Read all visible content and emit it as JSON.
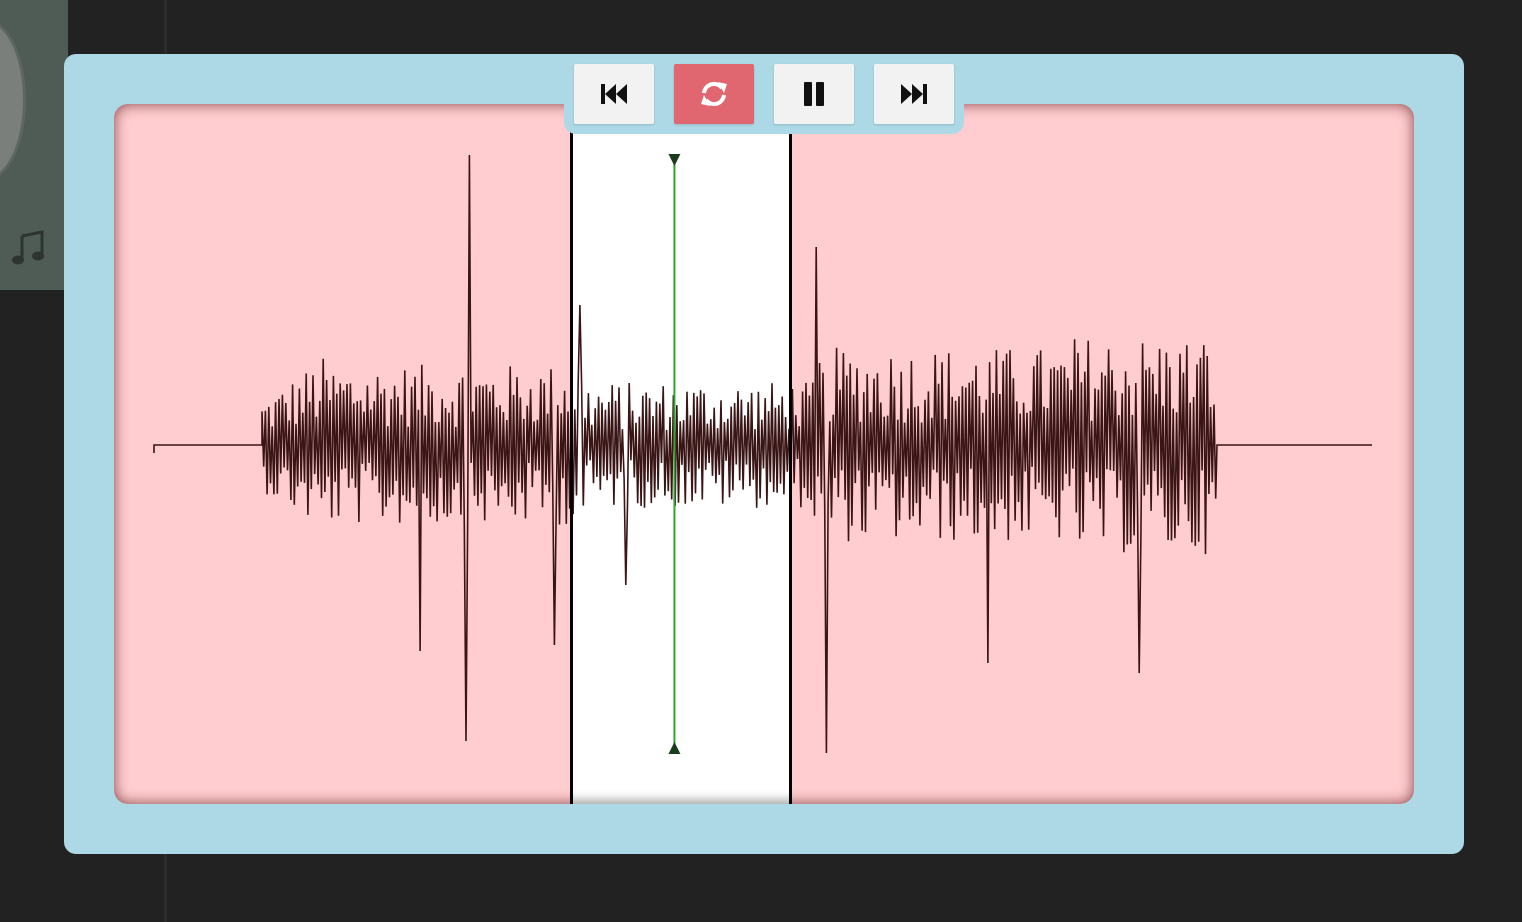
{
  "background": {
    "color": "#222222"
  },
  "side_card": {
    "icon": "music-note-icon"
  },
  "player": {
    "panel_color": "#add8e6",
    "waveform_bg": "#ffcdcf",
    "selected_region_bg": "#ffffff",
    "playhead_color": "#2fa52f",
    "waveform_color": "#3a1515"
  },
  "controls": [
    {
      "name": "skip-back-button",
      "icon": "skip-back-icon",
      "active": false
    },
    {
      "name": "loop-button",
      "icon": "loop-icon",
      "active": true
    },
    {
      "name": "pause-button",
      "icon": "pause-icon",
      "active": false
    },
    {
      "name": "skip-forward-button",
      "icon": "skip-forward-icon",
      "active": false
    }
  ],
  "selection": {
    "start_fraction": 0.3518,
    "end_fraction": 0.5207
  },
  "playhead": {
    "position_fraction": 0.4311
  },
  "loop_active": true
}
